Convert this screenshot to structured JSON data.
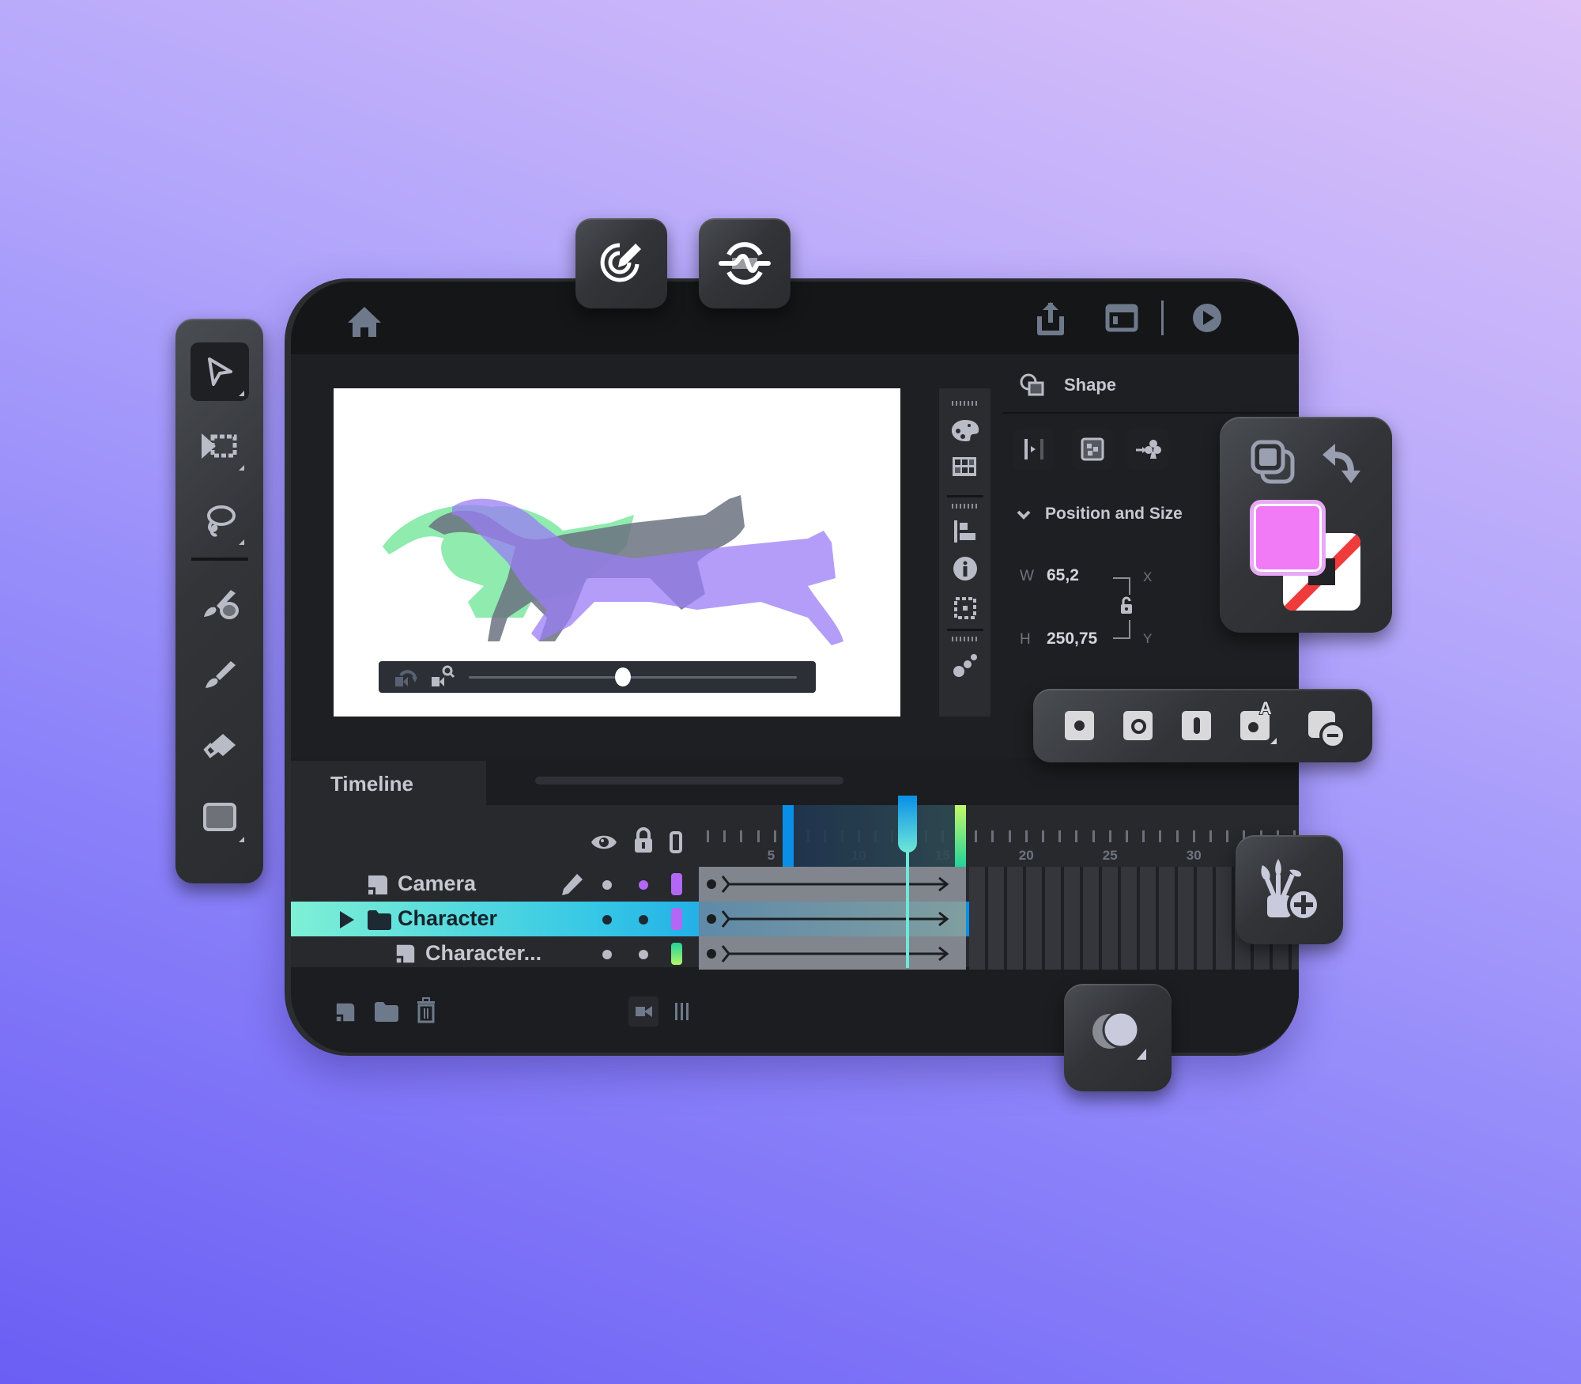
{
  "colors": {
    "accent_blue": "#0a8fe6",
    "accent_cyan": "#6fe8d8",
    "accent_green": "#b6f56a",
    "swatch_fill": "#f17bf6",
    "swatch_stroke_none": "#ef3b3b",
    "layer_purple": "#b268f4",
    "layer_green": "#22d39a"
  },
  "topbar": {
    "icons": [
      "home-icon",
      "share-icon",
      "window-icon",
      "play-icon"
    ]
  },
  "floating_top": [
    "pen-target-icon",
    "wave-balance-icon"
  ],
  "tools": [
    "select-arrow",
    "transform",
    "lasso",
    "paint-brush-fill",
    "brush",
    "eraser",
    "rectangle"
  ],
  "canvas": {
    "playback_slider_value": 0.47
  },
  "properties": {
    "title": "Shape",
    "section": "Position and Size",
    "w_label": "W",
    "w_value": "65,2",
    "h_label": "H",
    "h_value": "250,75",
    "x_label": "X",
    "y_label": "Y"
  },
  "timeline": {
    "title": "Timeline",
    "ruler_labels": [
      "5",
      "10",
      "15",
      "20",
      "25",
      "30"
    ],
    "current_frame": 13,
    "range_start": 6,
    "range_end": 16,
    "layers": [
      {
        "name": "Camera",
        "type": "camera",
        "color": "#b268f4"
      },
      {
        "name": "Character",
        "type": "folder",
        "color": "#b268f4",
        "selected": true
      },
      {
        "name": "Character...",
        "type": "layer",
        "color": "#22d39a"
      }
    ]
  }
}
